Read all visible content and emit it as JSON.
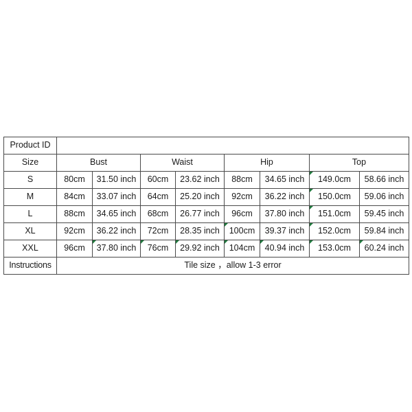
{
  "table": {
    "product_id_label": "Product ID",
    "product_id_value": "",
    "size_label": "Size",
    "group_headers": [
      "Bust",
      "Waist",
      "Hip",
      "Top"
    ],
    "rows": [
      {
        "size": "S",
        "bust_cm": "80cm",
        "bust_in": "31.50 inch",
        "waist_cm": "60cm",
        "waist_in": "23.62 inch",
        "hip_cm": "88cm",
        "hip_in": "34.65 inch",
        "top_cm": "149.0cm",
        "top_in": "58.66 inch"
      },
      {
        "size": "M",
        "bust_cm": "84cm",
        "bust_in": "33.07 inch",
        "waist_cm": "64cm",
        "waist_in": "25.20 inch",
        "hip_cm": "92cm",
        "hip_in": "36.22 inch",
        "top_cm": "150.0cm",
        "top_in": "59.06 inch"
      },
      {
        "size": "L",
        "bust_cm": "88cm",
        "bust_in": "34.65 inch",
        "waist_cm": "68cm",
        "waist_in": "26.77 inch",
        "hip_cm": "96cm",
        "hip_in": "37.80 inch",
        "top_cm": "151.0cm",
        "top_in": "59.45 inch"
      },
      {
        "size": "XL",
        "bust_cm": "92cm",
        "bust_in": "36.22 inch",
        "waist_cm": "72cm",
        "waist_in": "28.35 inch",
        "hip_cm": "100cm",
        "hip_in": "39.37 inch",
        "top_cm": "152.0cm",
        "top_in": "59.84 inch"
      },
      {
        "size": "XXL",
        "bust_cm": "96cm",
        "bust_in": "37.80 inch",
        "waist_cm": "76cm",
        "waist_in": "29.92 inch",
        "hip_cm": "104cm",
        "hip_in": "40.94 inch",
        "top_cm": "153.0cm",
        "top_in": "60.24 inch"
      }
    ],
    "instructions_label": "Instructions",
    "instructions_text": "Tile size ，allow 1-3 error",
    "colors": {
      "border": "#4a4a4a",
      "text": "#1a1a1a",
      "background": "#ffffff",
      "comment_marker": "#1f7a3d"
    }
  }
}
